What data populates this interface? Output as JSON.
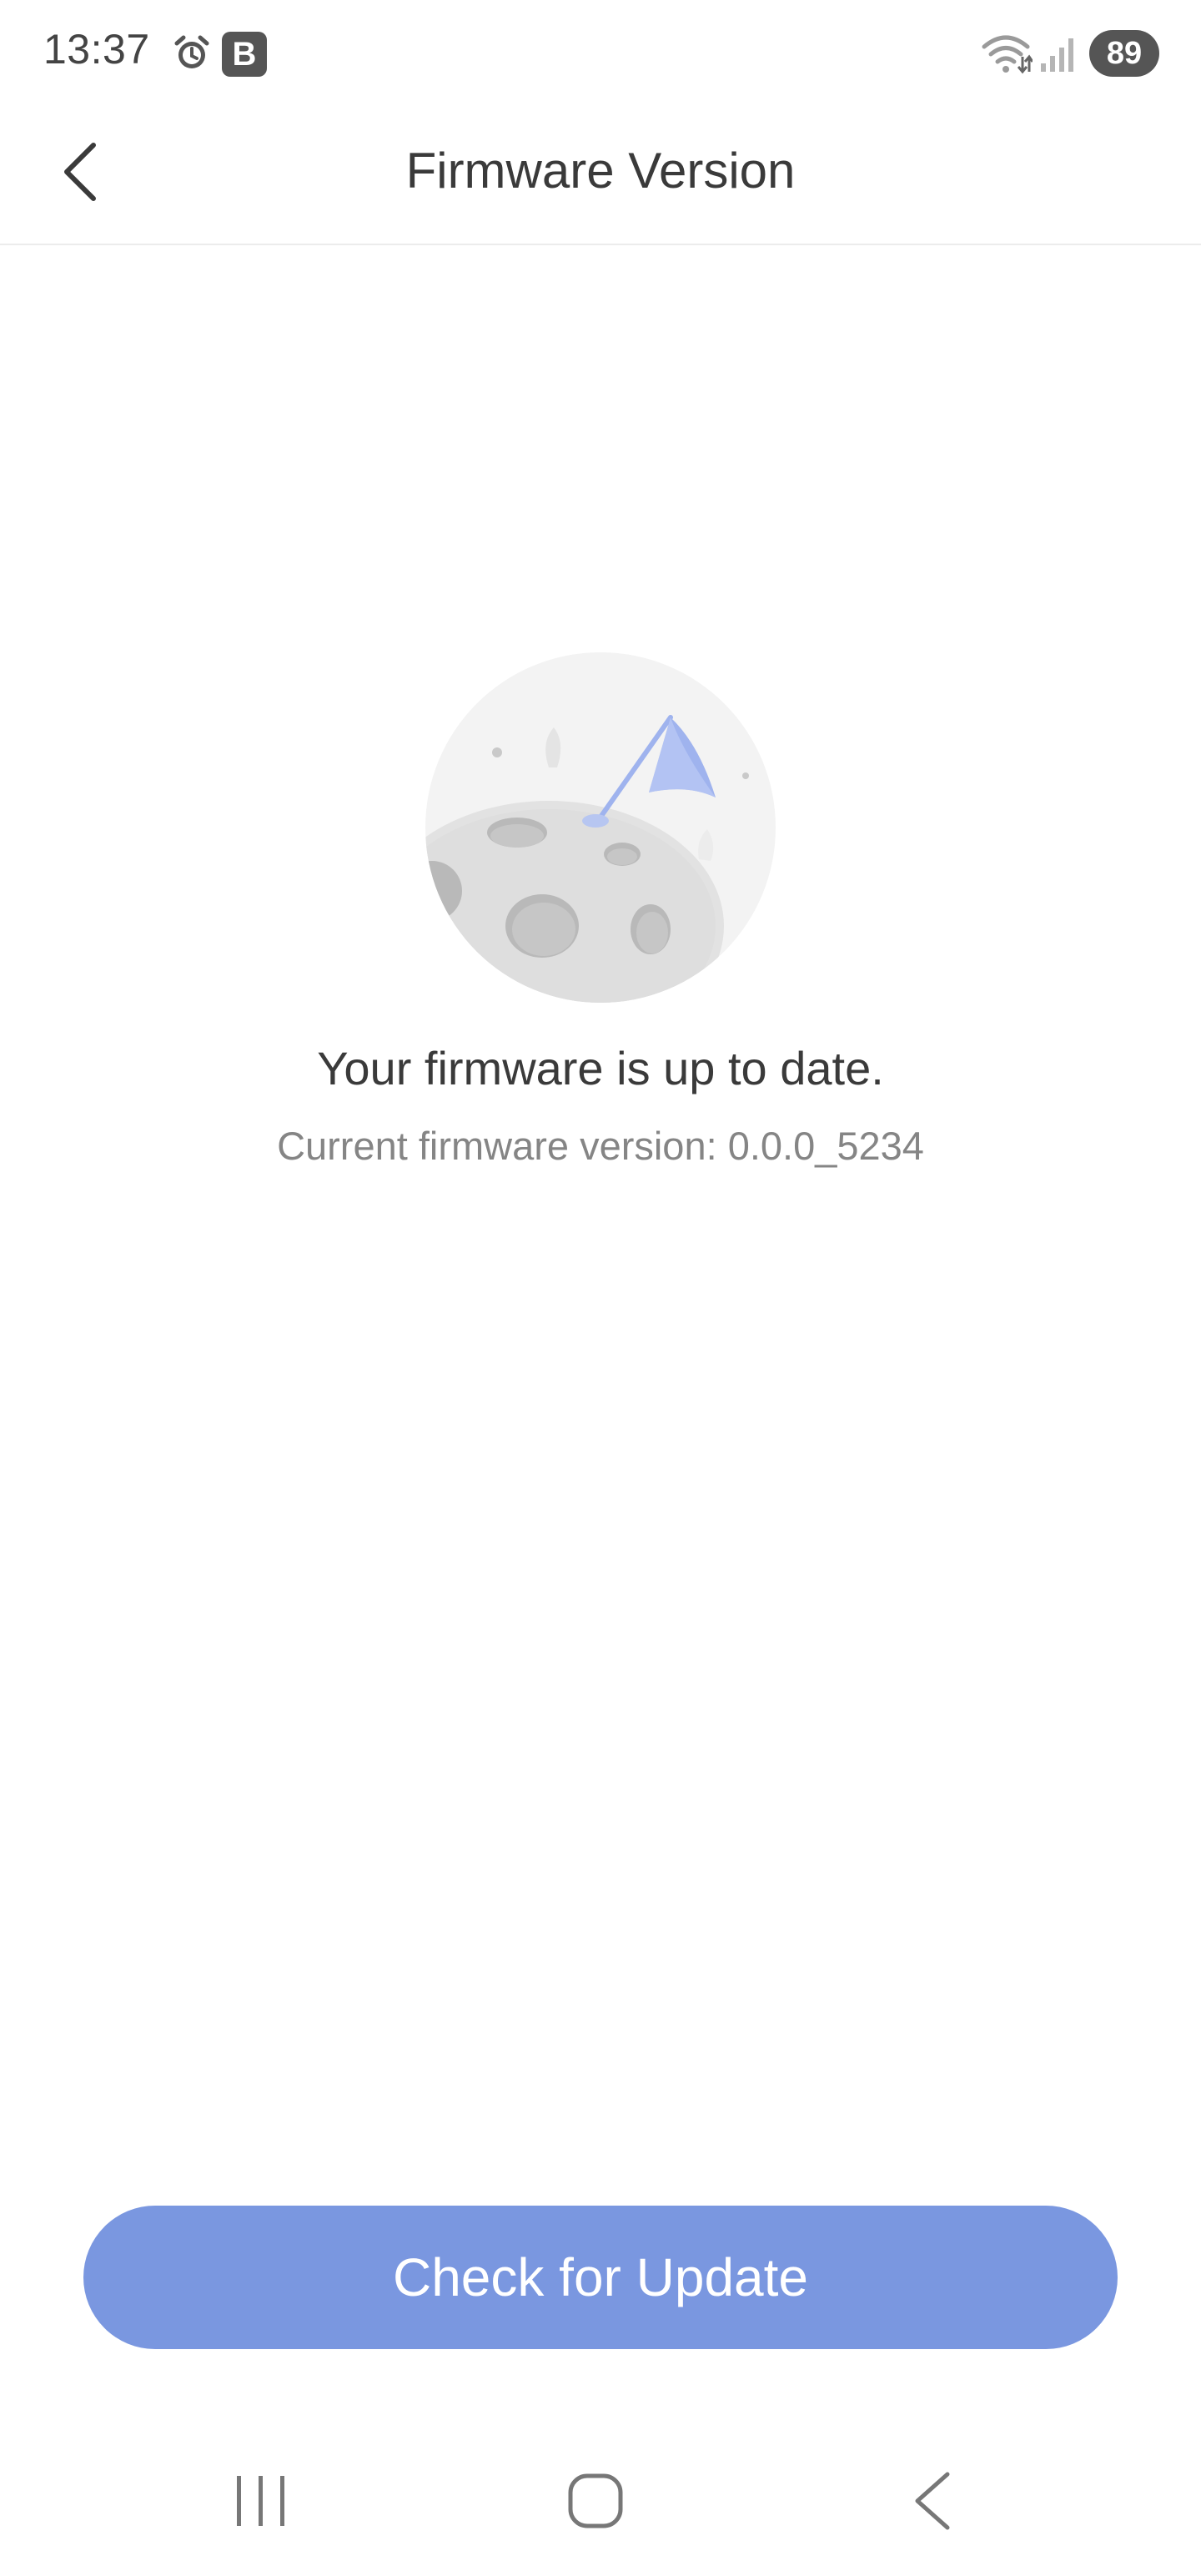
{
  "status_bar": {
    "time": "13:37",
    "app_badge": "B",
    "battery_level": "89",
    "icons": [
      "alarm-icon",
      "wifi-icon",
      "signal-icon"
    ]
  },
  "header": {
    "title": "Firmware Version",
    "back_icon": "chevron-left-icon"
  },
  "main": {
    "illustration": "moon-flag-illustration",
    "status_title": "Your firmware is up to date.",
    "version_text": "Current firmware version: 0.0.0_5234"
  },
  "actions": {
    "check_update_label": "Check for Update"
  },
  "nav_bar": {
    "icons": [
      "recents-icon",
      "home-icon",
      "back-icon"
    ]
  },
  "colors": {
    "accent": "#7a97e0",
    "flag": "#9fb3ee",
    "moon": "#d8d8d8",
    "title_text": "#3a3a3a",
    "secondary_text": "#858585"
  }
}
